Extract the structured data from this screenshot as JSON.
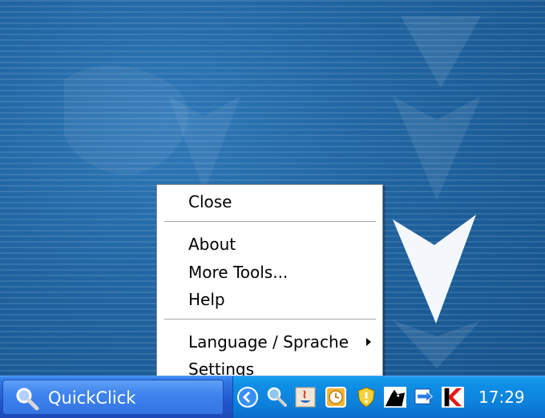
{
  "context_menu": {
    "items": [
      {
        "label": "Close"
      },
      {
        "label": "About"
      },
      {
        "label": "More Tools..."
      },
      {
        "label": "Help"
      },
      {
        "label": "Language / Sprache"
      },
      {
        "label": "Settings"
      }
    ]
  },
  "taskbar": {
    "task_button": {
      "label": "QuickClick",
      "icon": "magnifier-icon"
    },
    "tray": {
      "icons": [
        "show-hidden-icons-chevron-icon",
        "magnifier-icon",
        "java-icon",
        "clock-icon",
        "security-shield-icon",
        "cat-icon",
        "network-sync-icon",
        "kaspersky-icon"
      ],
      "clock": "17:29"
    }
  },
  "colors": {
    "desktop_blue": "#1f639f",
    "taskbar_blue": "#2456cf",
    "tray_blue": "#0f8fe6",
    "menu_background": "#ffffff"
  }
}
